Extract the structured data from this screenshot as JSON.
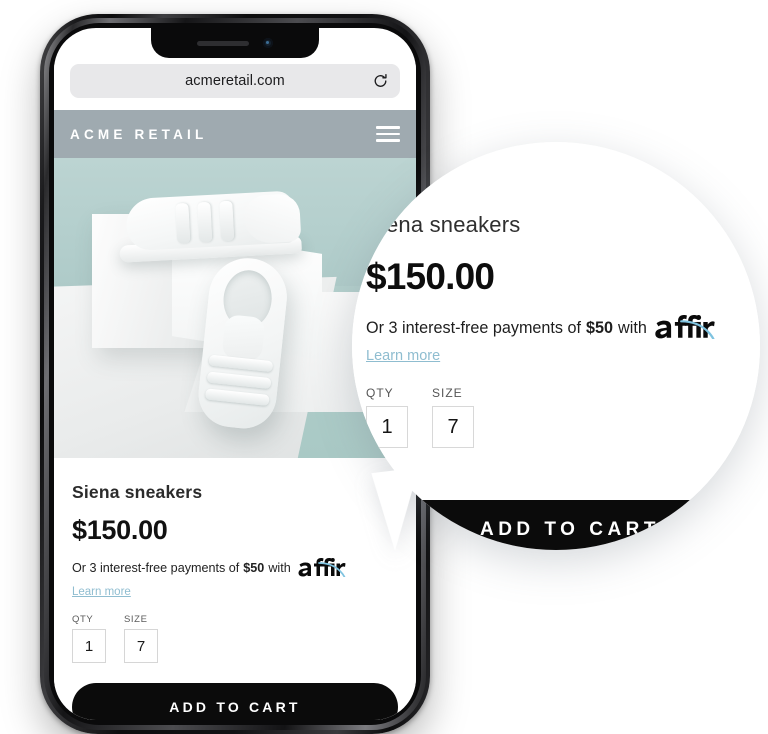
{
  "browser": {
    "url": "acmeretail.com",
    "reload_icon": "reload-icon"
  },
  "site_header": {
    "brand": "ACME RETAIL",
    "menu_icon": "hamburger-menu-icon"
  },
  "hero": {
    "alt": "white velcro strap sneakers on white box, mint background",
    "bg_color": "#b3cfcc"
  },
  "product": {
    "title": "Siena sneakers",
    "price": "$150.00",
    "financing_prefix": "Or 3 interest-free payments of",
    "financing_amount": "$50",
    "financing_with": "with",
    "financing_provider": "affirm",
    "learn_more": "Learn more",
    "qty_label": "QTY",
    "qty_value": "1",
    "size_label": "SIZE",
    "size_value": "7",
    "add_to_cart": "ADD TO CART"
  },
  "magnifier": {
    "title": "Siena sneakers",
    "price": "$150.00",
    "financing_prefix": "Or 3 interest-free payments of",
    "financing_amount": "$50",
    "financing_with": "with",
    "financing_provider": "affirm",
    "learn_more": "Learn more",
    "qty_label": "QTY",
    "qty_value": "1",
    "size_label": "SIZE",
    "size_value": "7",
    "add_to_cart": "ADD TO CART"
  },
  "colors": {
    "header_bar": "#9faab0",
    "hero_background": "#b3cfcc",
    "button": "#0b0b0b",
    "link": "#8fbdd0",
    "affirm_arc": "#7fc3e0",
    "page_background": "#ffffff"
  }
}
